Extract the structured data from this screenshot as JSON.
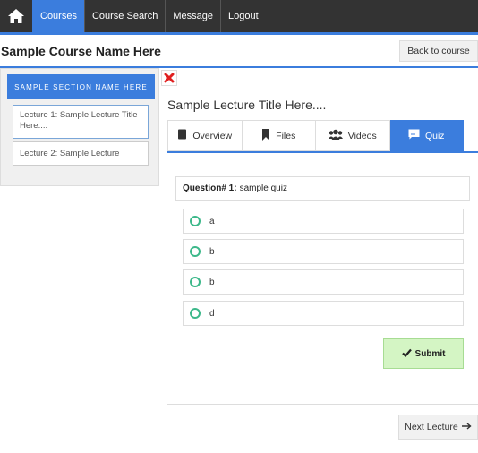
{
  "nav": {
    "items": [
      "Courses",
      "Course Search",
      "Message",
      "Logout"
    ],
    "active_index": 0
  },
  "header": {
    "course_title": "Sample Course Name Here",
    "back_label": "Back to course"
  },
  "sidebar": {
    "section_name": "SAMPLE SECTION NAME HERE",
    "lectures": [
      "Lecture 1: Sample Lecture Title Here....",
      "Lecture 2: Sample Lecture"
    ]
  },
  "main": {
    "lecture_title": "Sample Lecture Title Here....",
    "tabs": [
      {
        "label": "Overview",
        "icon": "book-icon"
      },
      {
        "label": "Files",
        "icon": "bookmark-icon"
      },
      {
        "label": "Videos",
        "icon": "users-icon"
      },
      {
        "label": "Quiz",
        "icon": "comment-icon"
      }
    ],
    "active_tab": 3
  },
  "quiz": {
    "question_label": "Question# 1:",
    "question_text": "sample quiz",
    "options": [
      "a",
      "b",
      "b",
      "d"
    ],
    "submit_label": "Submit"
  },
  "footer": {
    "next_label": "Next Lecture"
  },
  "colors": {
    "accent": "#3b7ddd",
    "nav_bg": "#333333",
    "radio": "#3cb88a",
    "submit_bg": "#d4f5c4",
    "close": "#e02020"
  }
}
